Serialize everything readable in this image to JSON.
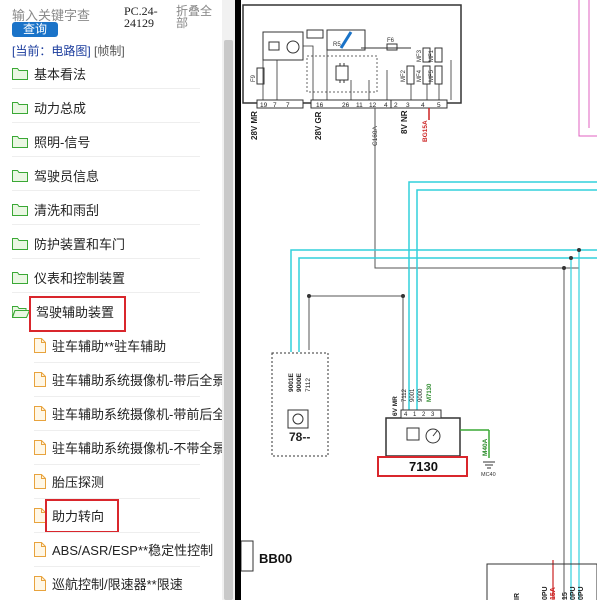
{
  "search": {
    "placeholder": "输入关键字查",
    "button_label": "查询"
  },
  "pc_code": "PC.24-24129",
  "collapse_all_label": "折叠全部",
  "breadcrumb": {
    "current": "[当前：电路图]",
    "link": "[帧制]"
  },
  "tree": {
    "categories": [
      {
        "label": "基本看法"
      },
      {
        "label": "动力总成"
      },
      {
        "label": "照明-信号"
      },
      {
        "label": "驾驶员信息"
      },
      {
        "label": "清洗和雨刮"
      },
      {
        "label": "防护装置和车门"
      },
      {
        "label": "仪表和控制装置"
      },
      {
        "label": "驾驶辅助装置"
      }
    ],
    "docs": [
      {
        "label": "驻车辅助**驻车辅助"
      },
      {
        "label": "驻车辅助系统摄像机-带后全景"
      },
      {
        "label": "驻车辅助系统摄像机-带前后全景"
      },
      {
        "label": "驻车辅助系统摄像机-不带全景"
      },
      {
        "label": "胎压探测"
      },
      {
        "label": "助力转向"
      },
      {
        "label": "ABS/ASR/ESP**稳定性控制"
      },
      {
        "label": "巡航控制/限速器**限速"
      }
    ]
  },
  "diagram": {
    "top_pins": [
      "19",
      "7",
      "7",
      "16",
      "26",
      "11",
      "12",
      "4",
      "2",
      "3",
      "4",
      "5"
    ],
    "components": {
      "f9": "F9",
      "f6": "F6",
      "r5": "R5",
      "mf1": "MF1",
      "mf2": "MF2",
      "mf3": "MF3",
      "mf4": "MF4",
      "mf5": "MF5"
    },
    "connectors": {
      "c1": "28V MR",
      "c2": "28V GR",
      "c3": "C160A",
      "c4": "8V NR",
      "c5": "BG15A"
    },
    "wire_labels": {
      "w1": "9001E",
      "w2": "9000E",
      "w3": "7112"
    },
    "comp78": "78--",
    "comp7130": {
      "name": "7130",
      "conn": "6V MR",
      "wires": [
        "7112",
        "9001",
        "9000",
        "M7130"
      ],
      "pins": [
        "4",
        "1",
        "2",
        "3"
      ]
    },
    "ground": {
      "wire": "M40A",
      "label": "MC40"
    },
    "bb00": "BB00",
    "bottom_left": "IR",
    "bottom_wires": [
      "15A",
      "0PU",
      "15",
      "0PU",
      "0PU"
    ]
  },
  "colors": {
    "accent_blue": "#1a73c8",
    "highlight_red": "#d9262c",
    "folder_green": "#3aa835",
    "doc_orange": "#e8a33d",
    "wire_cyan": "#32d0dc",
    "wire_pink": "#e060c0",
    "wire_red": "#cc2222"
  }
}
